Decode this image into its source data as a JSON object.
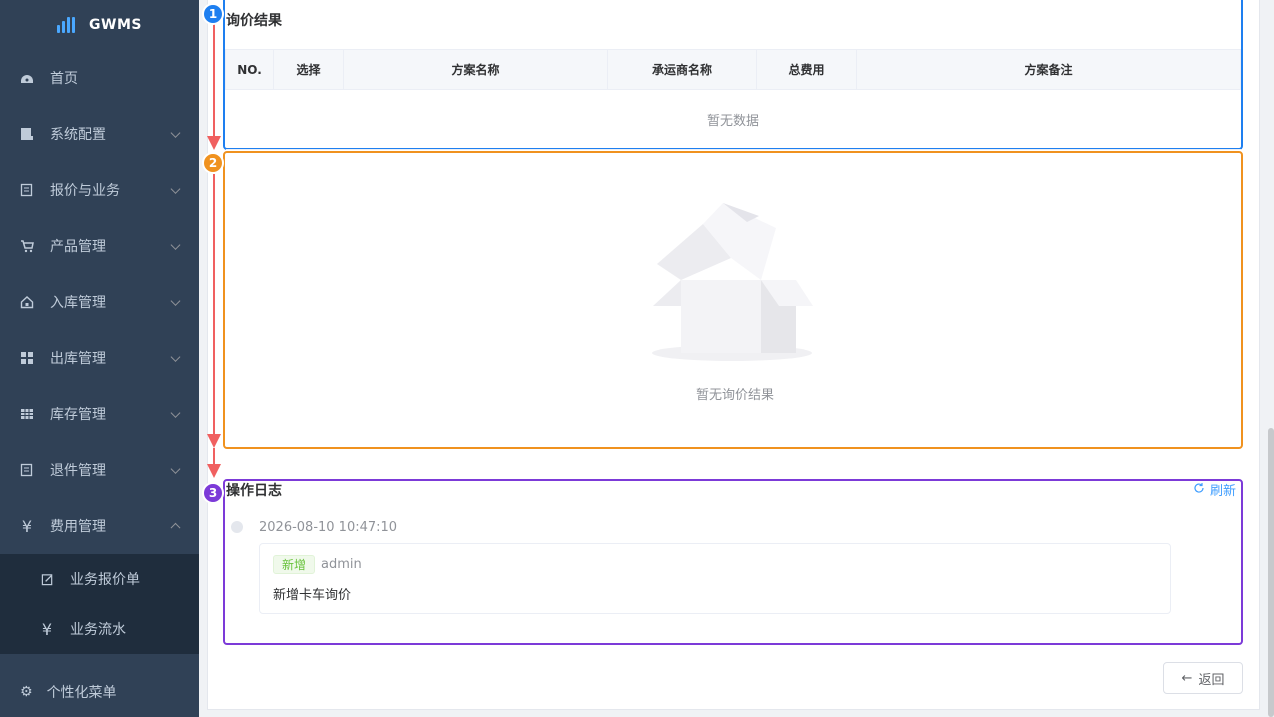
{
  "sidebar": {
    "brand": "GWMS",
    "items": [
      {
        "label": "首页",
        "icon": "dashboard-icon"
      },
      {
        "label": "系统配置",
        "icon": "system-icon"
      },
      {
        "label": "报价与业务",
        "icon": "quote-icon"
      },
      {
        "label": "产品管理",
        "icon": "cart-icon"
      },
      {
        "label": "入库管理",
        "icon": "home-icon"
      },
      {
        "label": "出库管理",
        "icon": "grid-icon"
      },
      {
        "label": "库存管理",
        "icon": "table-icon"
      },
      {
        "label": "退件管理",
        "icon": "return-icon"
      },
      {
        "label": "费用管理",
        "icon": "yen-icon"
      }
    ],
    "sub_items": [
      {
        "label": "业务报价单",
        "icon": "edit-icon"
      },
      {
        "label": "业务流水",
        "icon": "yen-icon"
      }
    ],
    "footer": "个性化菜单"
  },
  "results": {
    "title": "询价结果",
    "columns": [
      "NO.",
      "选择",
      "方案名称",
      "承运商名称",
      "总费用",
      "方案备注"
    ],
    "empty_text": "暂无数据"
  },
  "empty_state": {
    "text": "暂无询价结果"
  },
  "log": {
    "title": "操作日志",
    "refresh_label": "刷新",
    "entries": [
      {
        "time": "2026-08-10 10:47:10",
        "tag": "新增",
        "user": "admin",
        "message": "新增卡车询价"
      }
    ]
  },
  "back_label": "返回",
  "annotations": [
    "1",
    "2",
    "3"
  ],
  "colors": {
    "box1": "#1e7ff0",
    "box2": "#f0921f",
    "box3": "#7c3ad8",
    "arrow": "#f06060"
  }
}
